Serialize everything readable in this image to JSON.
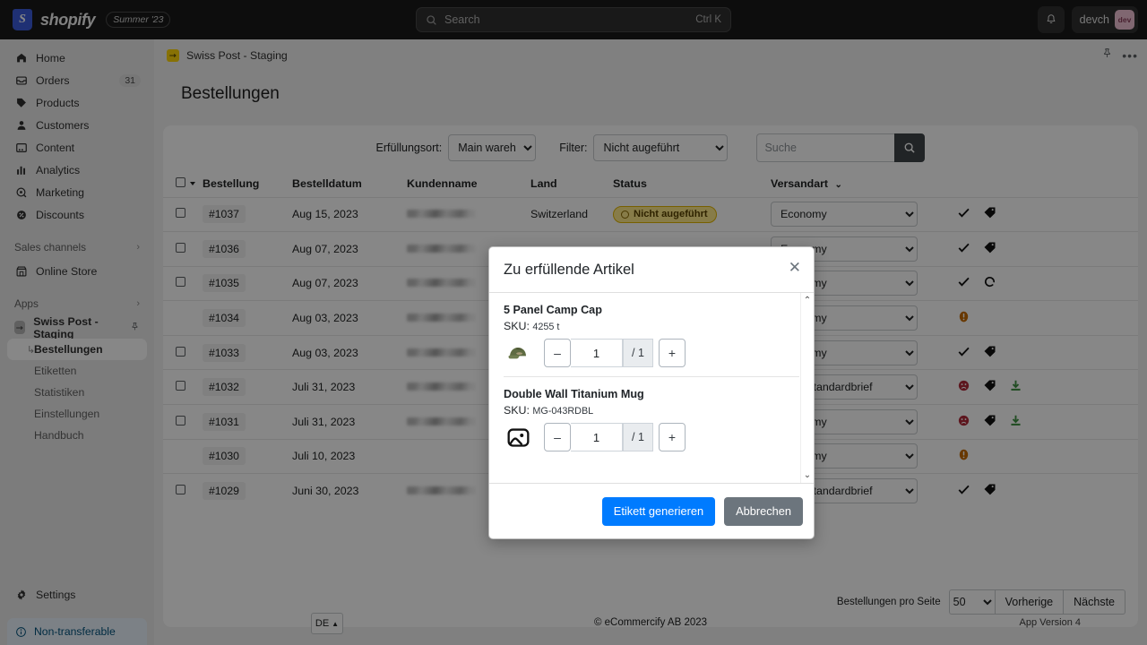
{
  "topbar": {
    "brand": "shopify",
    "brand_mark": "S",
    "season_badge": "Summer '23",
    "search_placeholder": "Search",
    "search_value": "",
    "search_shortcut": "Ctrl K",
    "user_name": "devch",
    "user_initials": "dev"
  },
  "sidebar": {
    "items": [
      {
        "label": "Home",
        "icon": "home-icon",
        "badge": ""
      },
      {
        "label": "Orders",
        "icon": "orders-icon",
        "badge": "31"
      },
      {
        "label": "Products",
        "icon": "products-icon",
        "badge": ""
      },
      {
        "label": "Customers",
        "icon": "customers-icon",
        "badge": ""
      },
      {
        "label": "Content",
        "icon": "content-icon",
        "badge": ""
      },
      {
        "label": "Analytics",
        "icon": "analytics-icon",
        "badge": ""
      },
      {
        "label": "Marketing",
        "icon": "marketing-icon",
        "badge": ""
      },
      {
        "label": "Discounts",
        "icon": "discounts-icon",
        "badge": ""
      }
    ],
    "sales_channels_label": "Sales channels",
    "online_store_label": "Online Store",
    "apps_label": "Apps",
    "app_name": "Swiss Post - Staging",
    "app_sub_items": [
      {
        "label": "Bestellungen",
        "active": true
      },
      {
        "label": "Etiketten",
        "active": false
      },
      {
        "label": "Statistiken",
        "active": false
      },
      {
        "label": "Einstellungen",
        "active": false
      },
      {
        "label": "Handbuch",
        "active": false
      }
    ],
    "settings_label": "Settings",
    "nontransferable_label": "Non-transferable"
  },
  "apphead": {
    "title": "Swiss Post - Staging",
    "pin_icon": "pin-icon",
    "more_icon": "more-horizontal-icon"
  },
  "page": {
    "title": "Bestellungen"
  },
  "filters": {
    "location_label": "Erfüllungsort:",
    "location_value": "Main warehouse",
    "location_options": [
      "Main warehouse"
    ],
    "filter_label": "Filter:",
    "filter_value": "Nicht augeführt",
    "filter_options": [
      "Nicht augeführt"
    ],
    "search_placeholder": "Suche",
    "search_value": "",
    "search_icon": "search-icon"
  },
  "table": {
    "columns": [
      "Bestellung",
      "Bestelldatum",
      "Kundenname",
      "Land",
      "Status",
      "Versandart"
    ],
    "sort_column": "Versandart",
    "rows": [
      {
        "order": "#1037",
        "date": "Aug 15, 2023",
        "customer": "",
        "country": "Switzerland",
        "status": "Nicht augeführt",
        "shipping": "Economy",
        "checkbox": true,
        "actions": [
          "check-icon",
          "tag-icon"
        ]
      },
      {
        "order": "#1036",
        "date": "Aug 07, 2023",
        "customer": "",
        "country": "",
        "status": "",
        "shipping": "Economy",
        "checkbox": true,
        "actions": [
          "check-icon",
          "tag-icon"
        ]
      },
      {
        "order": "#1035",
        "date": "Aug 07, 2023",
        "customer": "",
        "country": "",
        "status": "",
        "shipping": "Economy",
        "checkbox": true,
        "actions": [
          "check-icon",
          "refresh-icon"
        ]
      },
      {
        "order": "#1034",
        "date": "Aug 03, 2023",
        "customer": "",
        "country": "",
        "status": "",
        "shipping": "Economy",
        "checkbox": false,
        "actions": [
          "warning-icon"
        ]
      },
      {
        "order": "#1033",
        "date": "Aug 03, 2023",
        "customer": "",
        "country": "",
        "status": "",
        "shipping": "Economy",
        "checkbox": true,
        "actions": [
          "check-icon",
          "tag-icon"
        ]
      },
      {
        "order": "#1032",
        "date": "Juli 31, 2023",
        "customer": "",
        "country": "",
        "status": "",
        "shipping": "Post Standardbrief",
        "checkbox": true,
        "actions": [
          "error-icon",
          "tag-icon",
          "download-icon"
        ]
      },
      {
        "order": "#1031",
        "date": "Juli 31, 2023",
        "customer": "",
        "country": "",
        "status": "",
        "shipping": "Economy",
        "checkbox": true,
        "actions": [
          "error-icon",
          "tag-icon",
          "download-icon"
        ]
      },
      {
        "order": "#1030",
        "date": "Juli 10, 2023",
        "customer": "",
        "country": "",
        "status": "",
        "shipping": "Economy",
        "checkbox": false,
        "actions": [
          "warning-icon"
        ]
      },
      {
        "order": "#1029",
        "date": "Juni 30, 2023",
        "customer": "",
        "country": "",
        "status": "",
        "shipping": "Post Standardbrief",
        "checkbox": true,
        "actions": [
          "check-icon",
          "tag-icon"
        ]
      }
    ]
  },
  "pagination": {
    "label": "Bestellungen pro Seite",
    "per_page": "50",
    "per_page_options": [
      "50"
    ],
    "previous": "Vorherige",
    "next": "Nächste"
  },
  "footer": {
    "language": "DE",
    "copyright": "© eCommercify AB 2023",
    "app_version": "App Version 4"
  },
  "modal": {
    "title": "Zu erfüllende Artikel",
    "close_icon": "close-icon",
    "items": [
      {
        "name": "5 Panel Camp Cap",
        "sku_label": "SKU:",
        "sku": "4255 t",
        "thumb": "cap-image",
        "minus": "–",
        "qty": "1",
        "max": "/ 1",
        "plus": "+"
      },
      {
        "name": "Double Wall Titanium Mug",
        "sku_label": "SKU:",
        "sku": "MG-043RDBL",
        "thumb": "placeholder-image-icon",
        "minus": "–",
        "qty": "1",
        "max": "/ 1",
        "plus": "+"
      }
    ],
    "generate_label": "Etikett generieren",
    "cancel_label": "Abbrechen"
  },
  "colors": {
    "accent_blue": "#007bff",
    "cancel_gray": "#6c757d",
    "status_yellow": "#ffea8a",
    "warning_orange": "#c46a00",
    "error_red": "#b02a3a",
    "download_green": "#3f9142",
    "app_yellow": "#ffd60a"
  }
}
